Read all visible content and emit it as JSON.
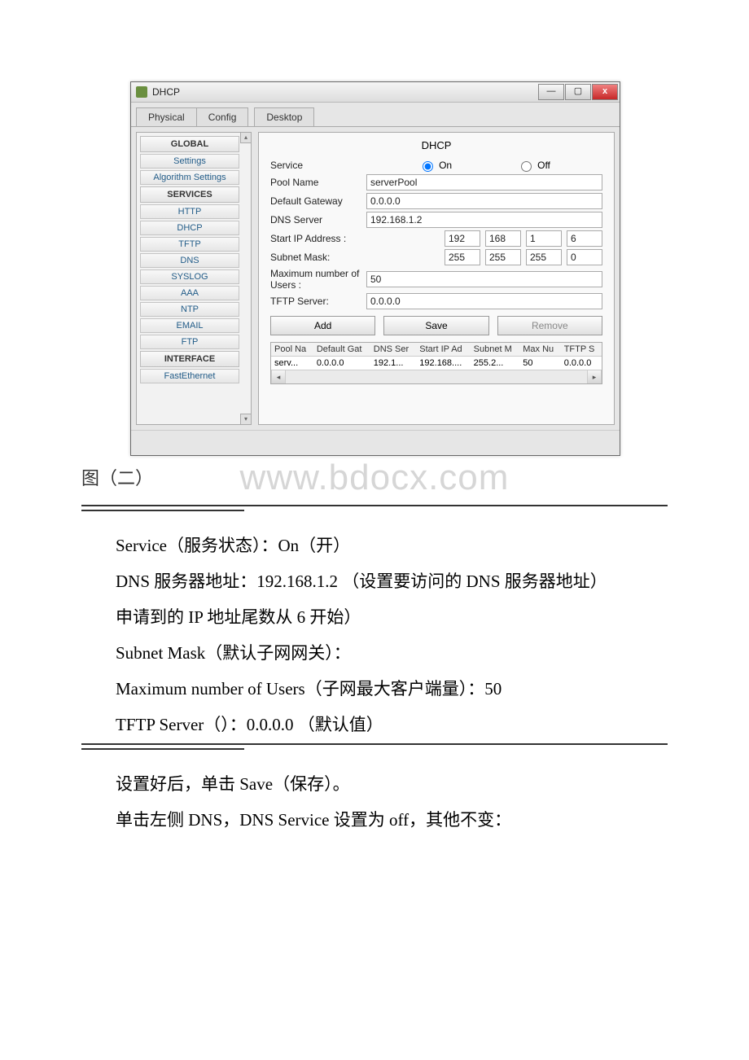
{
  "window": {
    "title": "DHCP",
    "tabs": [
      "Physical",
      "Config",
      "Desktop"
    ],
    "win_controls": {
      "min": "—",
      "max": "▢",
      "close": "x"
    }
  },
  "sidebar": {
    "groups": {
      "global_header": "GLOBAL",
      "global_items": [
        "Settings",
        "Algorithm Settings"
      ],
      "services_header": "SERVICES",
      "services_items": [
        "HTTP",
        "DHCP",
        "TFTP",
        "DNS",
        "SYSLOG",
        "AAA",
        "NTP",
        "EMAIL",
        "FTP"
      ],
      "interface_header": "INTERFACE",
      "interface_items": [
        "FastEthernet"
      ]
    }
  },
  "panel": {
    "title": "DHCP",
    "labels": {
      "service": "Service",
      "on": "On",
      "off": "Off",
      "pool_name": "Pool Name",
      "gateway": "Default Gateway",
      "dns": "DNS Server",
      "start_ip": "Start IP Address :",
      "subnet": "Subnet Mask:",
      "max_users": "Maximum number of Users :",
      "tftp": "TFTP Server:"
    },
    "values": {
      "pool_name": "serverPool",
      "gateway": "0.0.0.0",
      "dns": "192.168.1.2",
      "start_ip": [
        "192",
        "168",
        "1",
        "6"
      ],
      "subnet": [
        "255",
        "255",
        "255",
        "0"
      ],
      "max_users": "50",
      "tftp": "0.0.0.0"
    },
    "buttons": {
      "add": "Add",
      "save": "Save",
      "remove": "Remove"
    },
    "table": {
      "headers": [
        "Pool Na",
        "Default Gat",
        "DNS Ser",
        "Start IP Ad",
        "Subnet M",
        "Max Nu",
        "TFTP S"
      ],
      "row": [
        "serv...",
        "0.0.0.0",
        "192.1...",
        "192.168....",
        "255.2...",
        "50",
        "0.0.0.0"
      ]
    }
  },
  "doc": {
    "caption": "图（二）",
    "watermark": "www.bdocx.com",
    "p1": "Service（服务状态）：On（开）",
    "p2": "DNS 服务器地址：192.168.1.2 （设置要访问的 DNS 服务器地址）",
    "p3": "申请到的 IP 地址尾数从 6 开始）",
    "p4": "Subnet Mask（默认子网网关）：",
    "p5": "Maximum number of Users（子网最大客户端量）：50",
    "p6": "TFTP Server（）：0.0.0.0 （默认值）",
    "p7": "设置好后，单击 Save（保存）。",
    "p8": "单击左侧 DNS，DNS Service 设置为 off，其他不变："
  }
}
